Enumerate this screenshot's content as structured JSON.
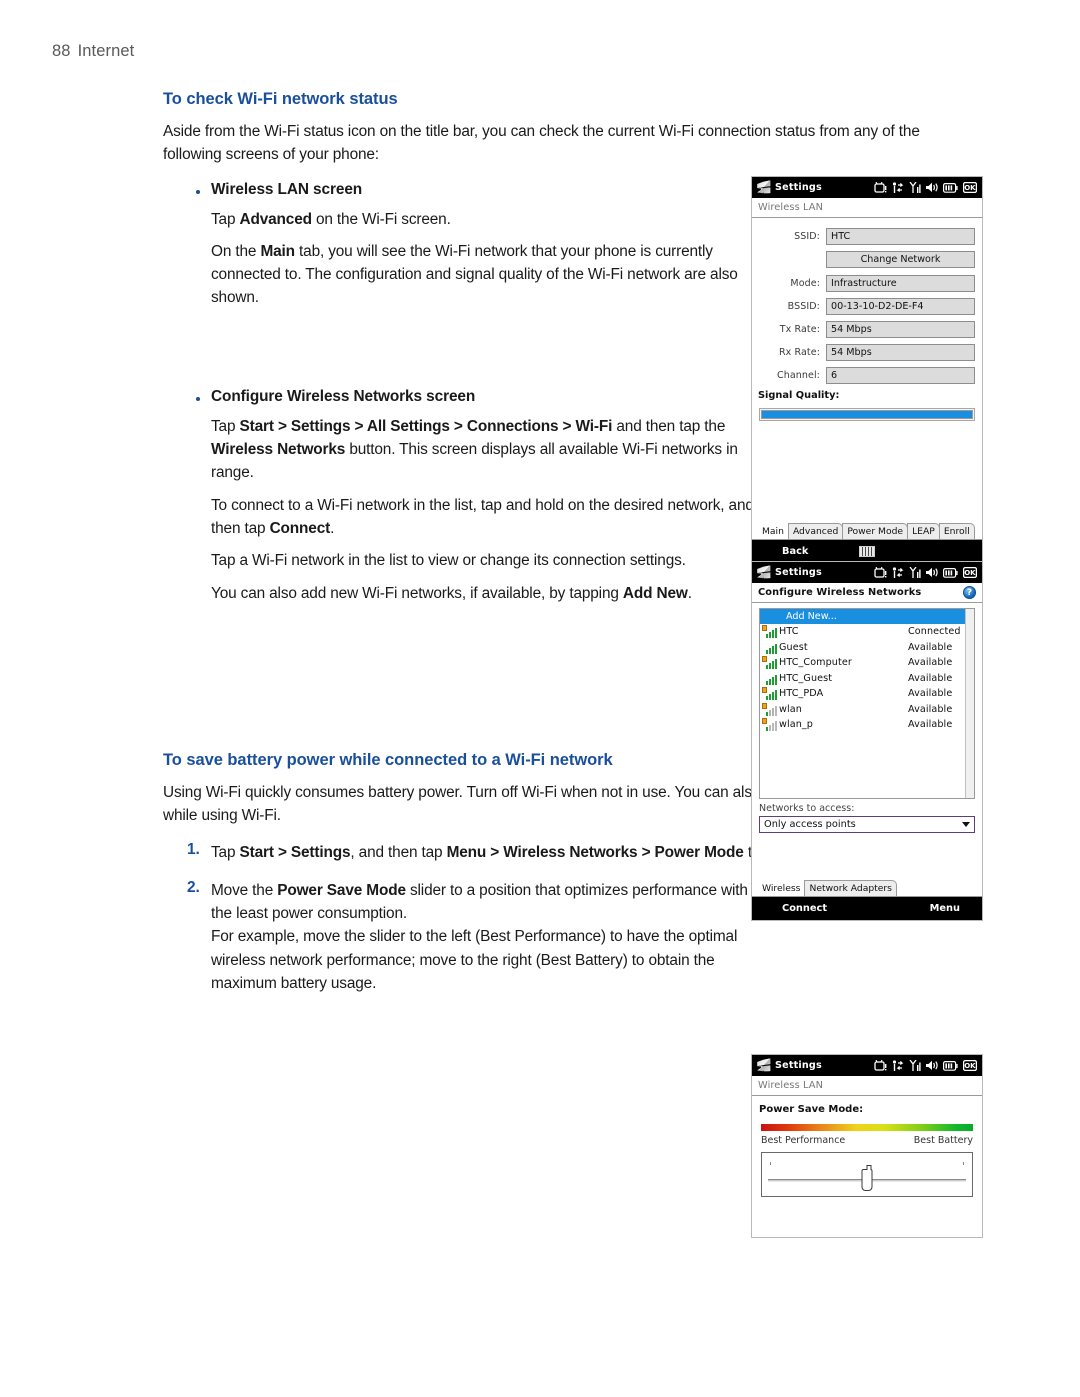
{
  "runhead": {
    "page_number": "88",
    "section": "Internet"
  },
  "sections": [
    {
      "heading": "To check Wi-Fi network status",
      "intro": "Aside from the Wi-Fi status icon on the title bar, you can check the current Wi-Fi connection status from any of the following screens of your phone:"
    },
    {
      "heading": "To save battery power while connected to a Wi-Fi network",
      "intro": "Using Wi-Fi quickly consumes battery power. Turn off Wi-Fi when not in use. You can also enable power saving settings while using Wi-Fi."
    }
  ],
  "bullets": [
    {
      "title": "Wireless LAN screen",
      "paras": [
        "Tap <b>Advanced</b> on the Wi-Fi screen.",
        "On the <b>Main</b> tab, you will see the Wi-Fi network that your phone is currently connected to. The configuration and signal quality of the Wi-Fi network are also shown."
      ]
    },
    {
      "title": "Configure Wireless Networks screen",
      "paras": [
        "Tap <b>Start &gt; Settings &gt; All Settings &gt;  Connections &gt; Wi-Fi</b> and then tap the <b>Wireless Networks</b> button. This screen displays all available Wi-Fi networks in range.",
        "To connect to a Wi-Fi network in the list, tap and hold on the desired network, and then tap <b>Connect</b>.",
        "Tap a Wi-Fi network in the list to view or change its connection settings.",
        "You can also add new Wi-Fi networks, if available, by tapping <b>Add New</b>."
      ]
    }
  ],
  "numbered": [
    {
      "num": "1.",
      "paras": [
        "Tap <b>Start &gt; Settings</b>, and then tap <b>Menu &gt; Wireless Networks &gt; Power Mode</b> tab."
      ]
    },
    {
      "num": "2.",
      "paras": [
        "Move the <b>Power Save Mode</b> slider to a position that optimizes performance with the least power consumption.",
        "For example, move the slider to the left (Best Performance) to have the optimal wireless network performance; move to the right (Best Battery) to obtain the maximum battery usage."
      ]
    }
  ],
  "screens": {
    "wireless_lan": {
      "title_bar": {
        "app": "Settings",
        "icons": [
          "alert-clock-icon",
          "connectivity-icon",
          "signal-bars-icon",
          "speaker-icon",
          "battery-icon",
          "ok-icon"
        ]
      },
      "subtitle": "Wireless LAN",
      "fields": [
        {
          "label": "SSID:",
          "value": "HTC"
        },
        {
          "label": "Mode:",
          "value": "Infrastructure"
        },
        {
          "label": "BSSID:",
          "value": "00-13-10-D2-DE-F4"
        },
        {
          "label": "Tx Rate:",
          "value": "54 Mbps"
        },
        {
          "label": "Rx Rate:",
          "value": "54 Mbps"
        },
        {
          "label": "Channel:",
          "value": "6"
        }
      ],
      "change_network_button": "Change Network",
      "signal_quality_label": "Signal Quality:",
      "signal_quality_percent": 100,
      "signal_bar_color": "#1a8fe0",
      "tabs": [
        "Main",
        "Advanced",
        "Power Mode",
        "LEAP",
        "Enroll"
      ],
      "active_tab": "Main",
      "softkey_left": "Back",
      "softkey_center_icon": "keyboard-icon"
    },
    "configure_wireless": {
      "title_bar": {
        "app": "Settings"
      },
      "subtitle": "Configure Wireless Networks",
      "help_icon": "?",
      "add_new": "Add New...",
      "networks": [
        {
          "name": "HTC",
          "status": "Connected",
          "secured": true,
          "strength": 4
        },
        {
          "name": "Guest",
          "status": "Available",
          "secured": false,
          "strength": 4
        },
        {
          "name": "HTC_Computer",
          "status": "Available",
          "secured": true,
          "strength": 4
        },
        {
          "name": "HTC_Guest",
          "status": "Available",
          "secured": false,
          "strength": 4
        },
        {
          "name": "HTC_PDA",
          "status": "Available",
          "secured": true,
          "strength": 4
        },
        {
          "name": "wlan",
          "status": "Available",
          "secured": true,
          "strength": 3
        },
        {
          "name": "wlan_p",
          "status": "Available",
          "secured": true,
          "strength": 1
        }
      ],
      "access_label": "Networks to access:",
      "access_value": "Only access points",
      "tabs": [
        "Wireless",
        "Network Adapters"
      ],
      "active_tab": "Wireless",
      "softkey_left": "Connect",
      "softkey_right": "Menu"
    },
    "power_save": {
      "title_bar": {
        "app": "Settings"
      },
      "subtitle": "Wireless LAN",
      "heading": "Power Save Mode:",
      "left_label": "Best Performance",
      "right_label": "Best Battery",
      "slider_position_percent": 50
    }
  },
  "colors": {
    "heading_blue": "#1a4f9c",
    "body_text": "#1a1a1a",
    "runhead_gray": "#58595b",
    "accent_blue": "#1a8fe0"
  }
}
